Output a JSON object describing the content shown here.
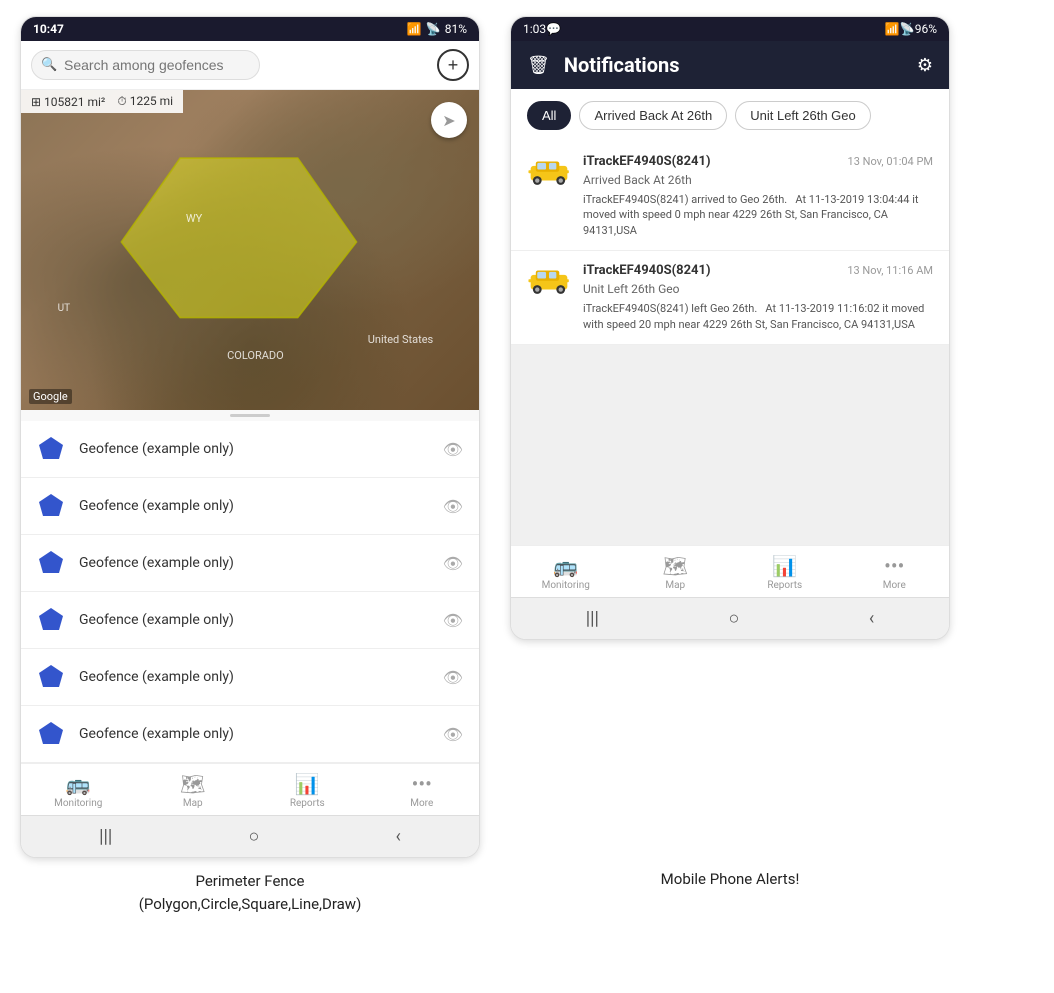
{
  "left_phone": {
    "status_bar": {
      "time": "10:47",
      "battery": "81%",
      "signal": "WiFi+LTE"
    },
    "search": {
      "placeholder": "Search among geofences"
    },
    "map_stats": {
      "area": "105821 mi²",
      "distance": "1225 mi"
    },
    "map_labels": {
      "wy": "WY",
      "colorado": "COLORADO",
      "us": "United States",
      "ut": "UT"
    },
    "geofences": [
      {
        "label": "Geofence (example only)"
      },
      {
        "label": "Geofence (example only)"
      },
      {
        "label": "Geofence (example only)"
      },
      {
        "label": "Geofence (example only)"
      },
      {
        "label": "Geofence (example only)"
      },
      {
        "label": "Geofence (example only)"
      }
    ],
    "nav": {
      "items": [
        "Monitoring",
        "Map",
        "Reports",
        "More"
      ]
    },
    "caption": "Perimeter Fence\n(Polygon,Circle,Square,Line,Draw)"
  },
  "right_phone": {
    "status_bar": {
      "time": "1:03",
      "battery": "96%"
    },
    "header": {
      "title": "Notifications",
      "trash_icon": "🗑",
      "gear_icon": "⚙"
    },
    "filters": [
      {
        "label": "All",
        "active": true
      },
      {
        "label": "Arrived Back At 26th",
        "active": false
      },
      {
        "label": "Unit Left 26th Geo",
        "active": false
      }
    ],
    "notifications": [
      {
        "device": "iTrackEF4940S(8241)",
        "time": "13 Nov, 01:04 PM",
        "event": "Arrived Back At 26th",
        "message": "iTrackEF4940S(8241) arrived to Geo 26th.   At 11-13-2019 13:04:44 it moved with speed 0 mph near 4229 26th St, San Francisco, CA 94131,USA"
      },
      {
        "device": "iTrackEF4940S(8241)",
        "time": "13 Nov, 11:16 AM",
        "event": "Unit Left 26th Geo",
        "message": "iTrackEF4940S(8241) left Geo 26th.   At 11-13-2019 11:16:02 it moved with speed 20 mph near 4229 26th St, San Francisco, CA 94131,USA"
      }
    ],
    "nav": {
      "items": [
        "Monitoring",
        "Map",
        "Reports",
        "More"
      ]
    },
    "caption": "Mobile Phone Alerts!"
  }
}
